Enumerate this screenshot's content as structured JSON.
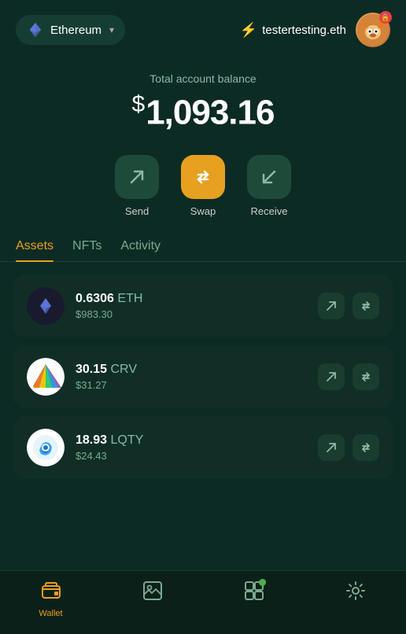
{
  "header": {
    "network": "Ethereum",
    "chevron": "▾",
    "ens_name": "testertesting.eth",
    "avatar_emoji": "🦊",
    "lock_icon": "🔒"
  },
  "balance": {
    "label": "Total account balance",
    "currency_symbol": "$",
    "amount": "1,093.16"
  },
  "actions": [
    {
      "id": "send",
      "label": "Send",
      "icon": "↗"
    },
    {
      "id": "swap",
      "label": "Swap",
      "icon": "⇄"
    },
    {
      "id": "receive",
      "label": "Receive",
      "icon": "↙"
    }
  ],
  "tabs": [
    {
      "id": "assets",
      "label": "Assets",
      "active": true
    },
    {
      "id": "nfts",
      "label": "NFTs",
      "active": false
    },
    {
      "id": "activity",
      "label": "Activity",
      "active": false
    }
  ],
  "assets": [
    {
      "symbol": "ETH",
      "amount": "0.6306",
      "usd": "$983.30",
      "logo_type": "eth"
    },
    {
      "symbol": "CRV",
      "amount": "30.15",
      "usd": "$31.27",
      "logo_type": "crv"
    },
    {
      "symbol": "LQTY",
      "amount": "18.93",
      "usd": "$24.43",
      "logo_type": "lqty"
    }
  ],
  "bottom_nav": [
    {
      "id": "wallet",
      "label": "Wallet",
      "active": true
    },
    {
      "id": "gallery",
      "label": "",
      "active": false
    },
    {
      "id": "apps",
      "label": "",
      "active": false,
      "has_dot": true
    },
    {
      "id": "settings",
      "label": "",
      "active": false
    }
  ],
  "colors": {
    "background": "#0d2b25",
    "card": "#102e26",
    "accent": "#e8a020",
    "text_secondary": "#8ab8a8"
  }
}
